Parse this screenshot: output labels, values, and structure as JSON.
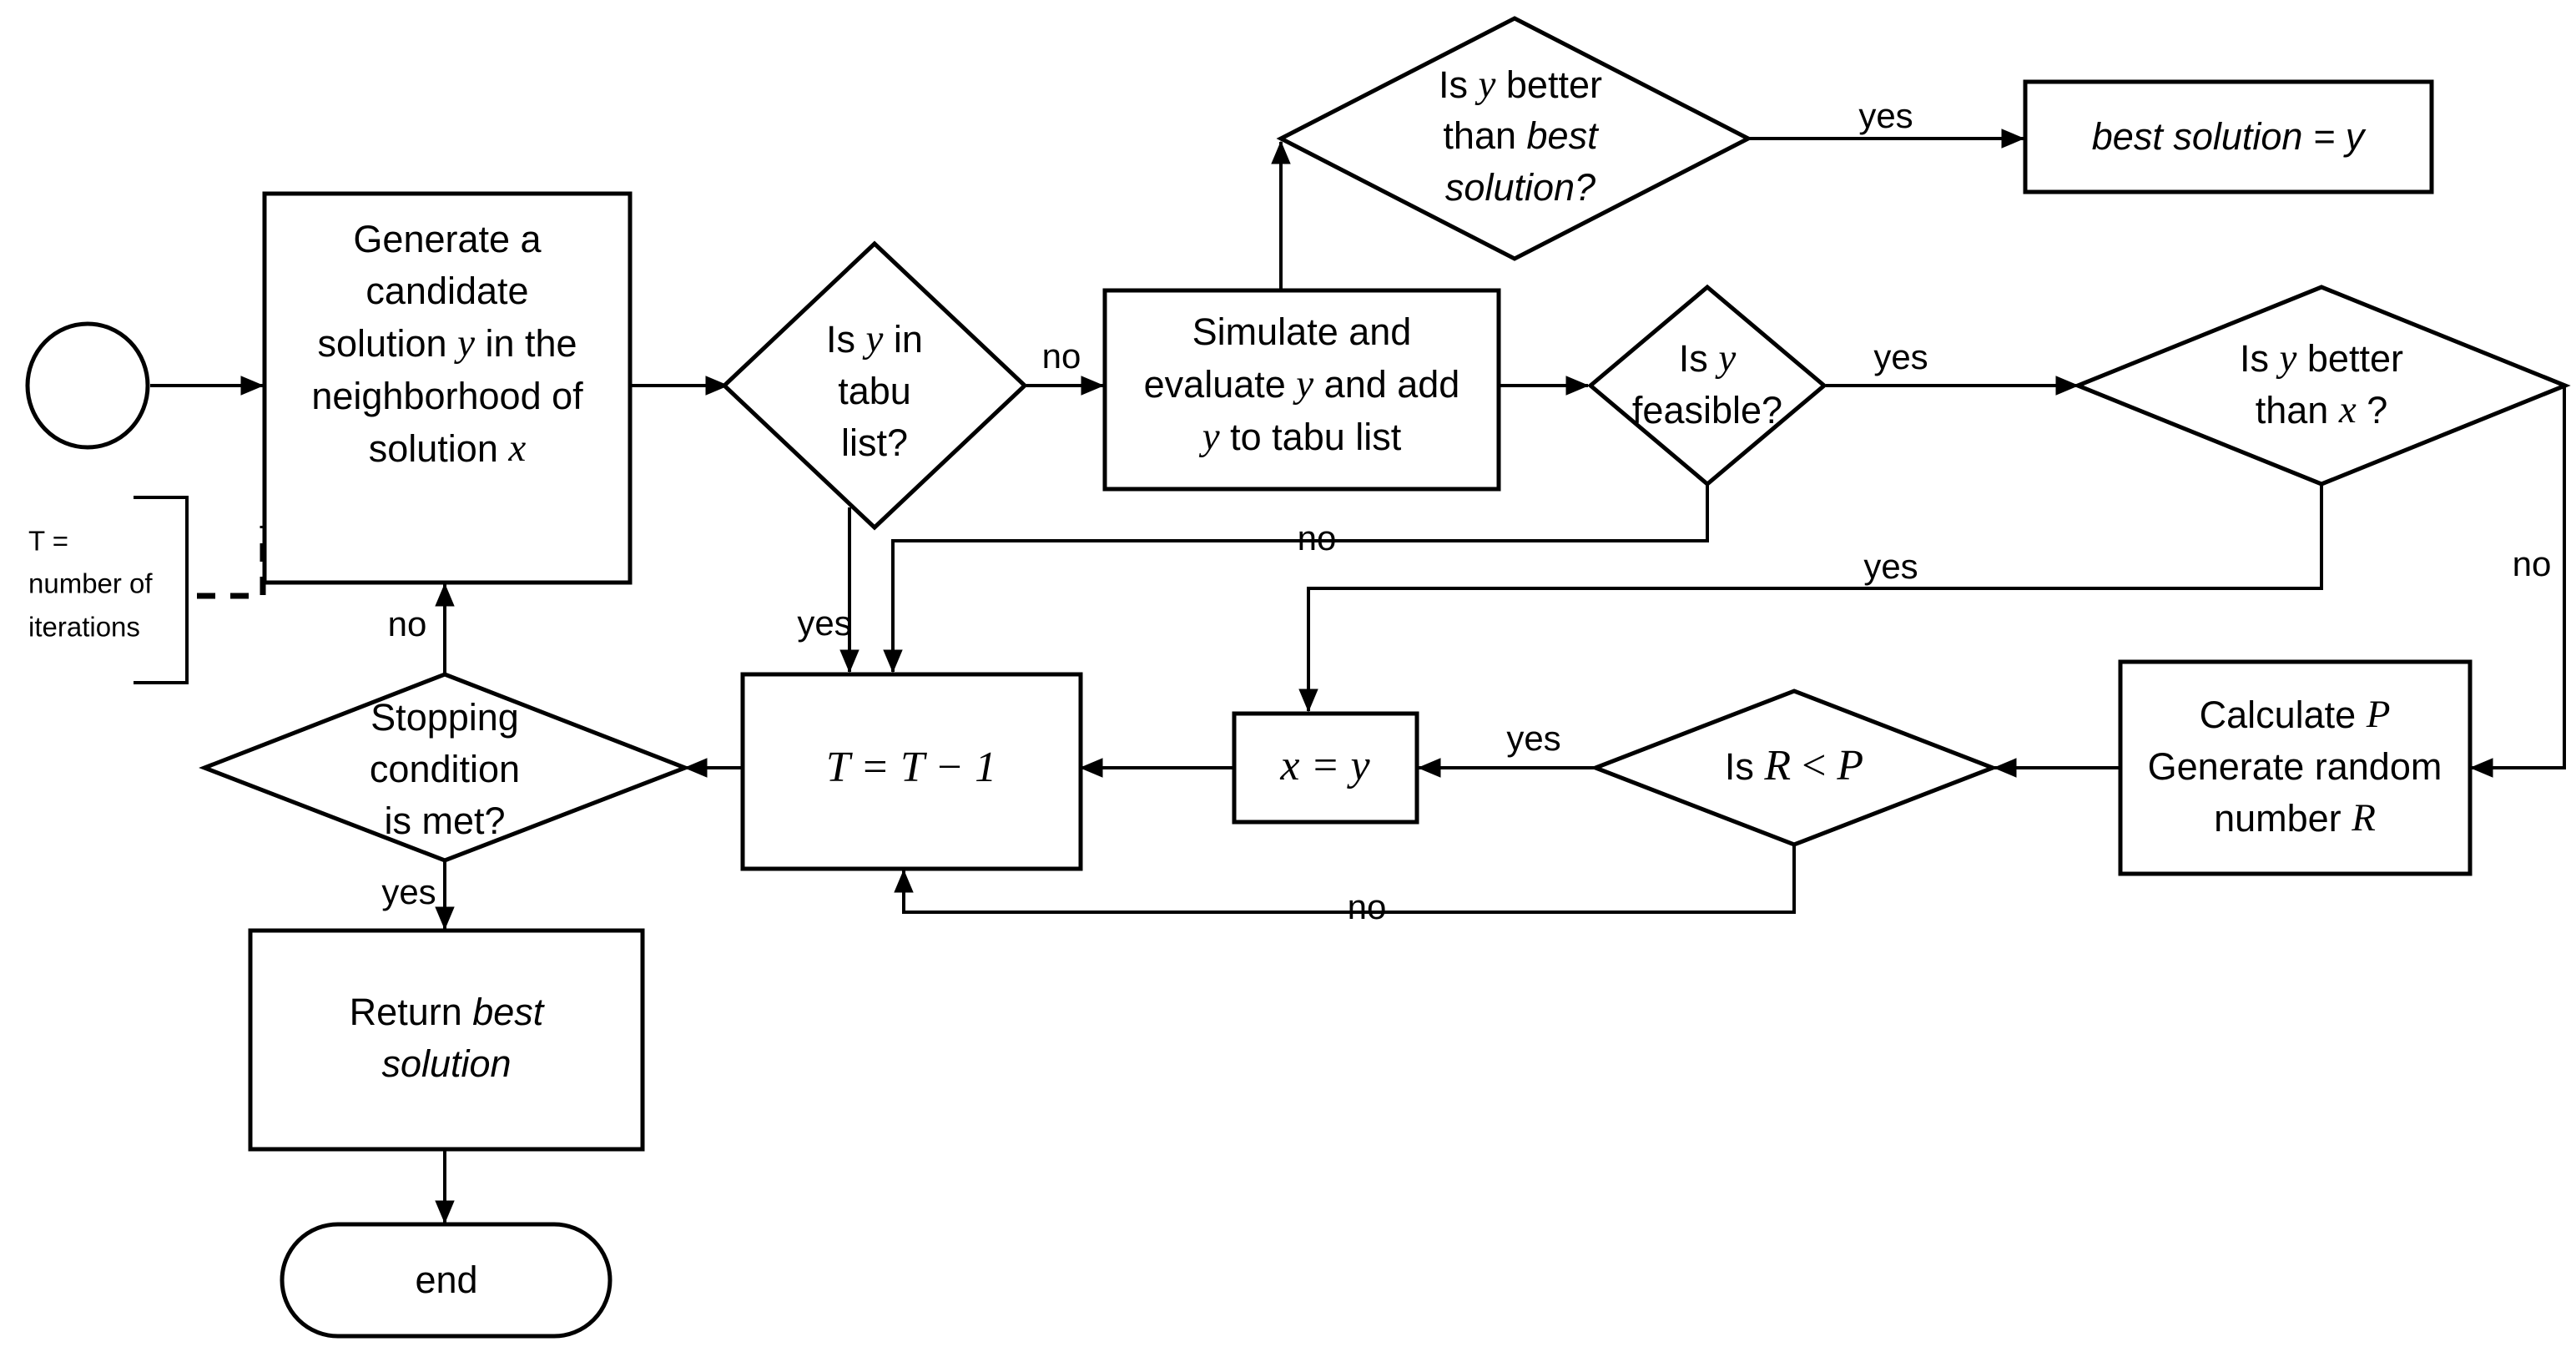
{
  "diagram": {
    "title": "Tabu search / simulated annealing hybrid flowchart",
    "background_color": "#ffffff",
    "line_color": "#000000"
  },
  "nodes": {
    "start": {
      "shape": "circle",
      "label": ""
    },
    "generate": {
      "shape": "process",
      "lines": [
        "Generate a",
        "candidate",
        "solution y in the",
        "neighborhood of",
        "solution x"
      ],
      "l1": "Generate a",
      "l2": "candidate",
      "l3a": "solution ",
      "l3b": "y",
      "l3c": " in the",
      "l4": "neighborhood of",
      "l5a": "solution ",
      "l5b": "x"
    },
    "tabu_check": {
      "shape": "decision",
      "l1a": "Is ",
      "l1b": "y",
      "l1c": " in",
      "l2": "tabu",
      "l3": "list?"
    },
    "simulate": {
      "shape": "process",
      "l1": "Simulate and",
      "l2a": "evaluate ",
      "l2b": "y",
      "l2c": " and add",
      "l3a": "y",
      "l3b": " to tabu list"
    },
    "better_than_best": {
      "shape": "decision",
      "l1a": "Is ",
      "l1b": "y",
      "l1c": "  better",
      "l2a": "than ",
      "l2b": "best",
      "l3": "solution?"
    },
    "assign_best": {
      "shape": "process",
      "text": "best solution = y"
    },
    "feasible": {
      "shape": "decision",
      "l1a": "Is ",
      "l1b": "y",
      "l2": "feasible?"
    },
    "better_than_x": {
      "shape": "decision",
      "l1a": "Is ",
      "l1b": "y",
      "l1c": " better",
      "l2a": "than ",
      "l2b": "x",
      "l2c": " ?"
    },
    "calc_p": {
      "shape": "process",
      "l1a": "Calculate ",
      "l1b": "P",
      "l2": "Generate random",
      "l3a": "number ",
      "l3b": "R"
    },
    "r_lt_p": {
      "shape": "decision",
      "l1a": "Is ",
      "l1b": "R",
      "l1c": " < ",
      "l1d": "P"
    },
    "assign_x": {
      "shape": "process",
      "text": "x = y"
    },
    "decrement_t": {
      "shape": "process",
      "text": "T = T − 1"
    },
    "stopping": {
      "shape": "decision",
      "l1": "Stopping",
      "l2": "condition",
      "l3": "is met?"
    },
    "return_best": {
      "shape": "process",
      "l1a": "Return ",
      "l1b": "best",
      "l2": "solution"
    },
    "end": {
      "shape": "terminator",
      "label": "end"
    }
  },
  "notes": {
    "t_definition": {
      "l1": "T =",
      "l2": "number of",
      "l3": "iterations"
    }
  },
  "edge_labels": {
    "tabu_no": "no",
    "tabu_yes": "yes",
    "best_yes": "yes",
    "feasible_yes": "yes",
    "feasible_no": "no",
    "better_x_yes": "yes",
    "better_x_no": "no",
    "rp_yes": "yes",
    "rp_no": "no",
    "stopping_no": "no",
    "stopping_yes": "yes"
  },
  "edges": [
    {
      "from": "start",
      "to": "generate",
      "label": ""
    },
    {
      "from": "generate",
      "to": "tabu_check",
      "label": ""
    },
    {
      "from": "tabu_check",
      "to": "simulate",
      "label": "no"
    },
    {
      "from": "tabu_check",
      "to": "decrement_t",
      "label": "yes"
    },
    {
      "from": "simulate",
      "to": "better_than_best",
      "label": ""
    },
    {
      "from": "better_than_best",
      "to": "assign_best",
      "label": "yes"
    },
    {
      "from": "simulate",
      "to": "feasible",
      "label": ""
    },
    {
      "from": "feasible",
      "to": "better_than_x",
      "label": "yes"
    },
    {
      "from": "feasible",
      "to": "decrement_t",
      "label": "no"
    },
    {
      "from": "better_than_x",
      "to": "assign_x",
      "label": "yes"
    },
    {
      "from": "better_than_x",
      "to": "calc_p",
      "label": "no"
    },
    {
      "from": "calc_p",
      "to": "r_lt_p",
      "label": ""
    },
    {
      "from": "r_lt_p",
      "to": "assign_x",
      "label": "yes"
    },
    {
      "from": "r_lt_p",
      "to": "decrement_t",
      "label": "no"
    },
    {
      "from": "assign_x",
      "to": "decrement_t",
      "label": ""
    },
    {
      "from": "decrement_t",
      "to": "stopping",
      "label": ""
    },
    {
      "from": "stopping",
      "to": "generate",
      "label": "no"
    },
    {
      "from": "stopping",
      "to": "return_best",
      "label": "yes"
    },
    {
      "from": "return_best",
      "to": "end",
      "label": ""
    },
    {
      "from": "t_definition",
      "to": "generate",
      "label": "",
      "style": "dashed"
    }
  ]
}
